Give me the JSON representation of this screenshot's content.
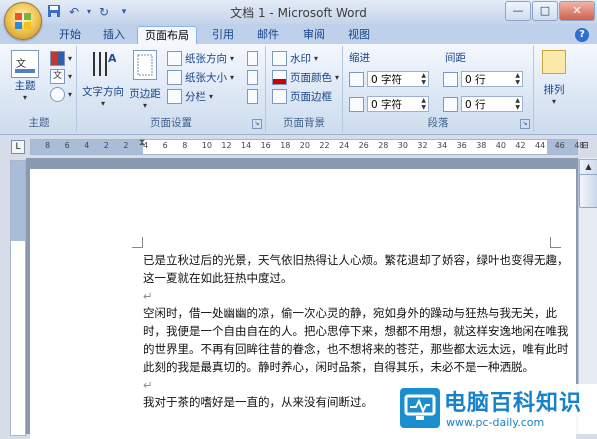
{
  "window": {
    "title": "文档 1 - Microsoft Word"
  },
  "qat": {
    "save": "save-icon",
    "undo": "undo-icon",
    "redo": "redo-icon",
    "more": "▾"
  },
  "tabs": [
    "开始",
    "插入",
    "页面布局",
    "引用",
    "邮件",
    "审阅",
    "视图"
  ],
  "active_tab": "页面布局",
  "ribbon": {
    "theme_group": {
      "label": "主题",
      "theme_button": "主题"
    },
    "page_setup": {
      "label": "页面设置",
      "text_direction": "文字方向",
      "margins": "页边距",
      "orientation": "纸张方向",
      "size": "纸张大小",
      "columns": "分栏"
    },
    "page_background": {
      "label": "页面背景",
      "watermark": "水印",
      "page_color": "页面颜色",
      "page_borders": "页面边框"
    },
    "paragraph": {
      "label": "段落",
      "indent_label": "缩进",
      "spacing_label": "间距",
      "indent_left": "0 字符",
      "indent_right": "0 字符",
      "spacing_before": "0 行",
      "spacing_after": "0 行"
    },
    "arrange": {
      "label": "排列"
    }
  },
  "ruler": {
    "ticks": [
      "8",
      "6",
      "4",
      "2",
      "2",
      "4",
      "6",
      "8",
      "10",
      "12",
      "14",
      "16",
      "18",
      "20",
      "22",
      "24",
      "26",
      "28",
      "30",
      "32",
      "34",
      "36",
      "38",
      "40",
      "42",
      "44",
      "46",
      "48"
    ]
  },
  "document": {
    "paragraphs": [
      "已是立秋过后的光景，天气依旧热得让人心烦。繁花退却了娇容，绿叶也变得无趣，这一夏就在如此狂热中度过。",
      "空闲时，借一处幽幽的凉，偷一次心灵的静，宛如身外的躁动与狂热与我无关，此时，我便是一个自由自在的人。把心思停下来，想都不用想，就这样安逸地闲在唯我的世界里。不再有回眸往昔的眷念，也不想将来的苍茫，那些都太远太远，唯有此时此刻的我是最真切的。静时养心，闲时品茶，自得其乐，未必不是一种洒脱。",
      "我对于茶的嗜好是一直的，从来没有间断过。"
    ],
    "para_mark": "↵"
  },
  "watermark": {
    "title": "电脑百科知识",
    "url": "www.pc-daily.com"
  }
}
